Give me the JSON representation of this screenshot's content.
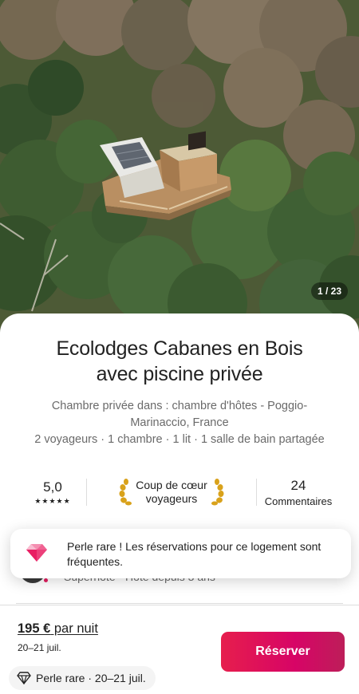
{
  "photo": {
    "counter": "1 / 23"
  },
  "listing": {
    "title_line1": "Ecolodges Cabanes en Bois",
    "title_line2": "avec piscine privée",
    "subtitle": "Chambre privée dans : chambre d'hôtes - Poggio-Marinaccio, France",
    "details": "2 voyageurs · 1 chambre · 1 lit · 1 salle de bain partagée"
  },
  "stats": {
    "rating": "5,0",
    "stars": "★★★★★",
    "favorite_line1": "Coup de cœur",
    "favorite_line2": "voyageurs",
    "reviews_count": "24",
    "reviews_label": "Commentaires"
  },
  "host": {
    "info": "Superhôte · Hôte depuis 3 ans"
  },
  "toast": {
    "icon": "gem-icon",
    "text": "Perle rare ! Les réservations pour ce logement sont fréquentes."
  },
  "footer": {
    "price": "195 €",
    "price_suffix": " par nuit",
    "dates": "20–21 juil.",
    "reserve_label": "Réserver",
    "rare_chip": "Perle rare · 20–21 juil."
  },
  "colors": {
    "accent": "#e31c5f",
    "text": "#222222",
    "muted": "#6a6a6a"
  }
}
